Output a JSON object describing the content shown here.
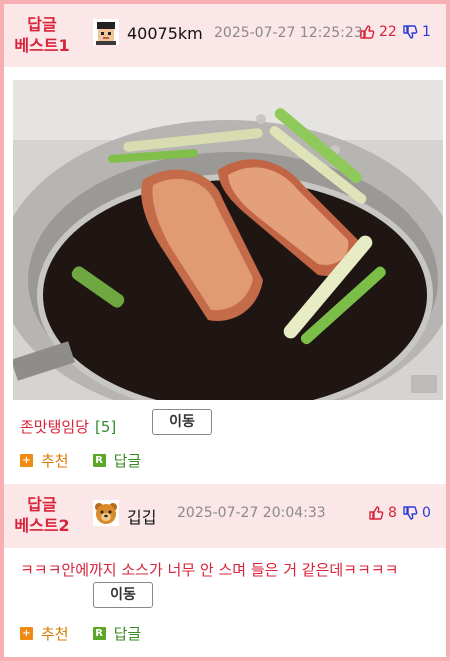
{
  "comments": [
    {
      "badge_line1": "답글",
      "badge_line2": "베스트1",
      "nickname": "40075km",
      "datetime": "2025-07-27 12:25:23",
      "upvotes": "22",
      "downvotes": "1",
      "title": "존맛탱임당",
      "reply_count": "[5]",
      "move_label": "이동",
      "recommend_label": "추천",
      "reply_label": "답글"
    },
    {
      "badge_line1": "답글",
      "badge_line2": "베스트2",
      "nickname": "깁깁",
      "datetime": "2025-07-27 20:04:33",
      "upvotes": "8",
      "downvotes": "0",
      "text": "ㅋㅋㅋ안에까지 소스가 너무 안 스며 들은 거 같은데ㅋㅋㅋㅋ",
      "move_label": "이동",
      "recommend_label": "추천",
      "reply_label": "답글"
    }
  ],
  "icons": {
    "plus_box": "+",
    "reply_box": "R"
  },
  "colors": {
    "border": "#f6b0b3",
    "header_bg": "#fbe6e8",
    "accent_red": "#d8243a",
    "down_blue": "#2b3bd6",
    "action_orange": "#d97a05",
    "reply_green": "#3a8a22"
  }
}
